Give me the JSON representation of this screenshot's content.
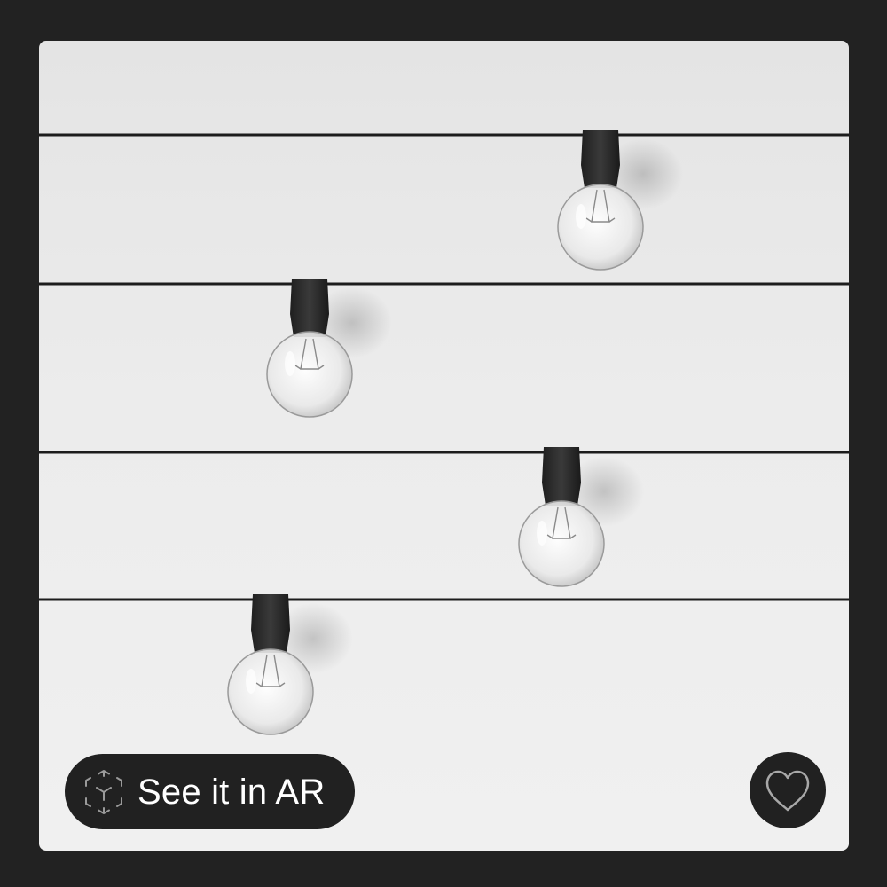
{
  "product_image": {
    "alt": "",
    "bulb_count": 4
  },
  "ar_button": {
    "label": "See it in AR",
    "icon": "ar-cube-icon"
  },
  "favorite_button": {
    "icon": "heart-outline-icon"
  },
  "colors": {
    "frame": "#222222",
    "pill_background": "#212121",
    "pill_text": "#ffffff",
    "cord": "#1c1c1c",
    "socket": "#2a2a2a"
  }
}
